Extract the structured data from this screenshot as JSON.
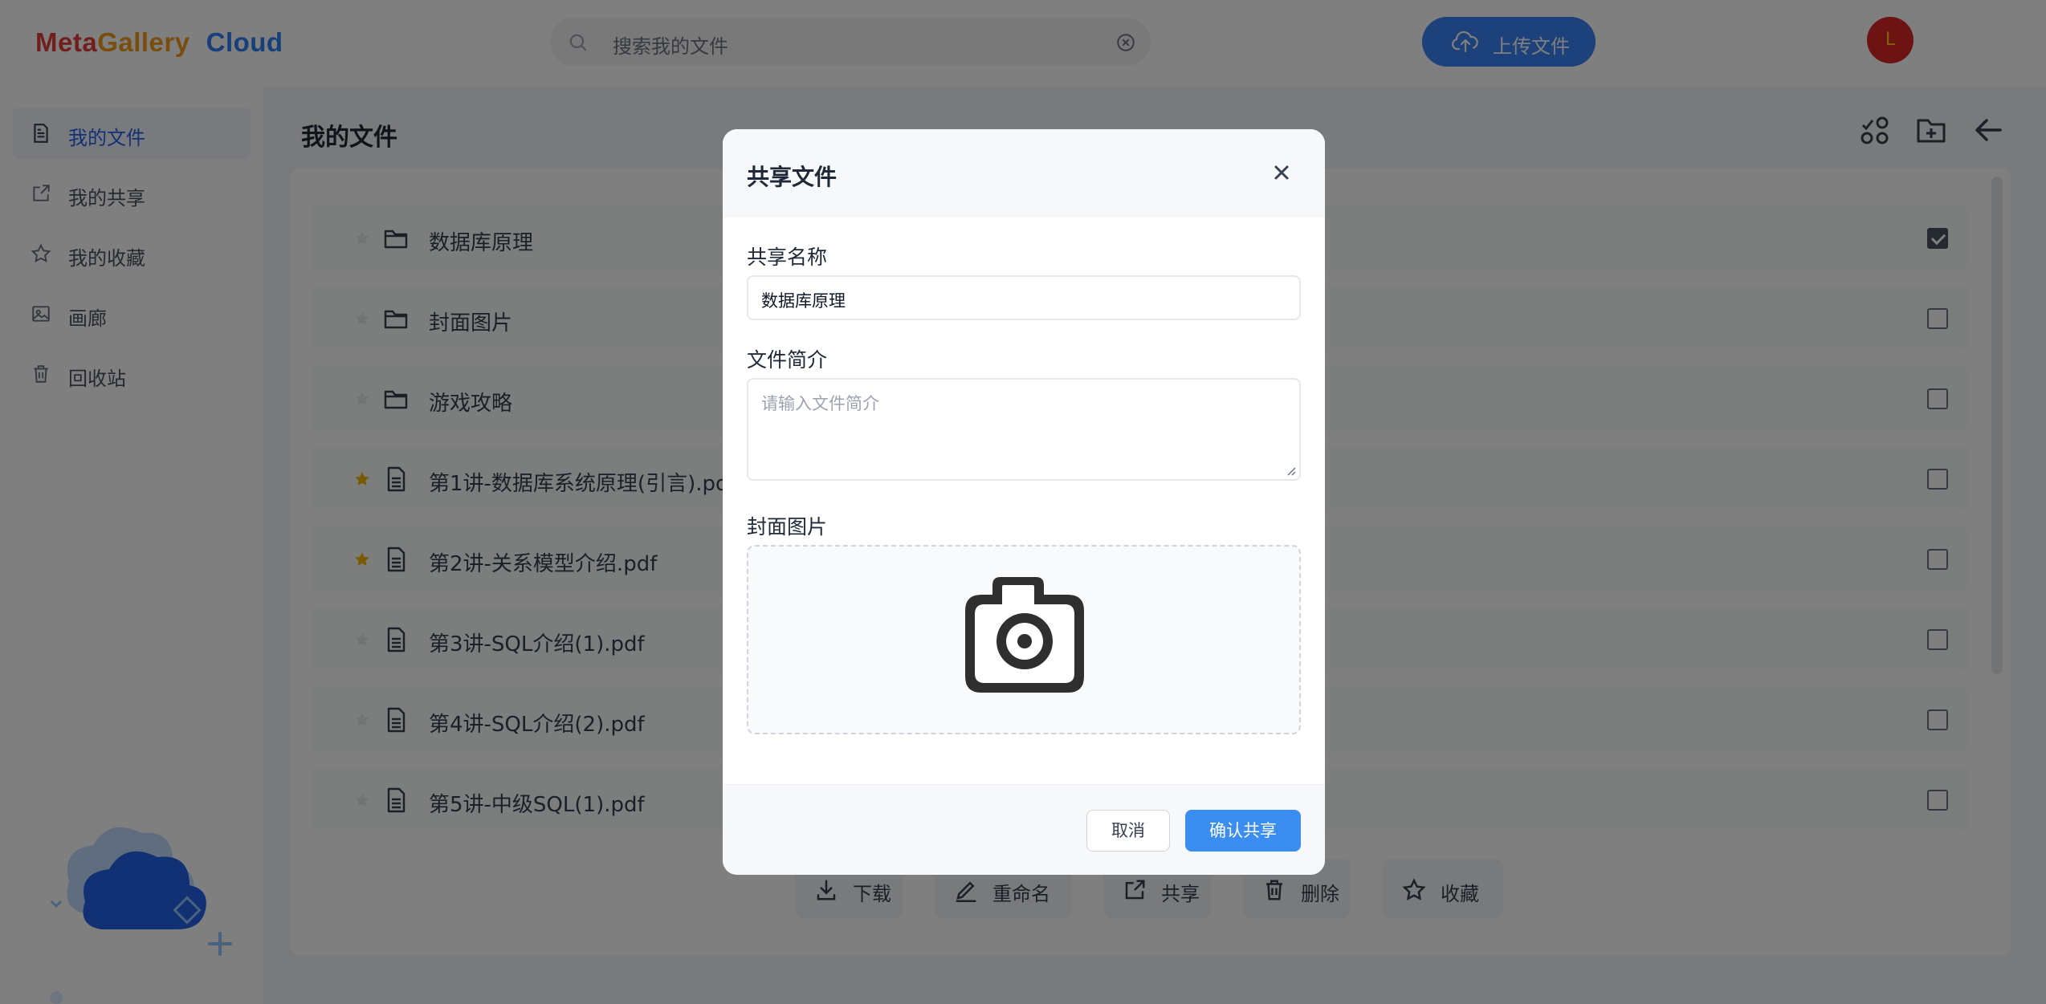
{
  "header": {
    "logo": {
      "word1": "Meta",
      "word2": "Gallery",
      "word3": "Cloud"
    },
    "search_placeholder": "搜索我的文件",
    "upload_label": "上传文件",
    "avatar_initial": "L"
  },
  "sidebar": {
    "items": [
      {
        "label": "我的文件",
        "icon": "document-icon",
        "active": true
      },
      {
        "label": "我的共享",
        "icon": "share-icon",
        "active": false
      },
      {
        "label": "我的收藏",
        "icon": "star-icon",
        "active": false
      },
      {
        "label": "画廊",
        "icon": "image-icon",
        "active": false
      },
      {
        "label": "回收站",
        "icon": "trash-icon",
        "active": false
      }
    ]
  },
  "main": {
    "title": "我的文件",
    "files": [
      {
        "name": "数据库原理",
        "type": "folder",
        "starred": false,
        "checked": true
      },
      {
        "name": "封面图片",
        "type": "folder",
        "starred": false,
        "checked": false
      },
      {
        "name": "游戏攻略",
        "type": "folder",
        "starred": false,
        "checked": false
      },
      {
        "name": "第1讲-数据库系统原理(引言).pdf",
        "type": "file",
        "starred": true,
        "checked": false
      },
      {
        "name": "第2讲-关系模型介绍.pdf",
        "type": "file",
        "starred": true,
        "checked": false
      },
      {
        "name": "第3讲-SQL介绍(1).pdf",
        "type": "file",
        "starred": false,
        "checked": false
      },
      {
        "name": "第4讲-SQL介绍(2).pdf",
        "type": "file",
        "starred": false,
        "checked": false
      },
      {
        "name": "第5讲-中级SQL(1).pdf",
        "type": "file",
        "starred": false,
        "checked": false
      }
    ],
    "actions": [
      {
        "label": "下载",
        "icon": "download-icon"
      },
      {
        "label": "重命名",
        "icon": "edit-icon"
      },
      {
        "label": "共享",
        "icon": "share-icon"
      },
      {
        "label": "删除",
        "icon": "trash-icon"
      },
      {
        "label": "收藏",
        "icon": "star-icon"
      }
    ]
  },
  "modal": {
    "title": "共享文件",
    "share_name_label": "共享名称",
    "share_name_value": "数据库原理",
    "desc_label": "文件简介",
    "desc_placeholder": "请输入文件简介",
    "cover_label": "封面图片",
    "cancel_label": "取消",
    "confirm_label": "确认共享"
  },
  "colors": {
    "accent": "#3b82f6",
    "star": "#f5b301",
    "avatar_bg": "#dc2626",
    "avatar_fg": "#facc15"
  }
}
